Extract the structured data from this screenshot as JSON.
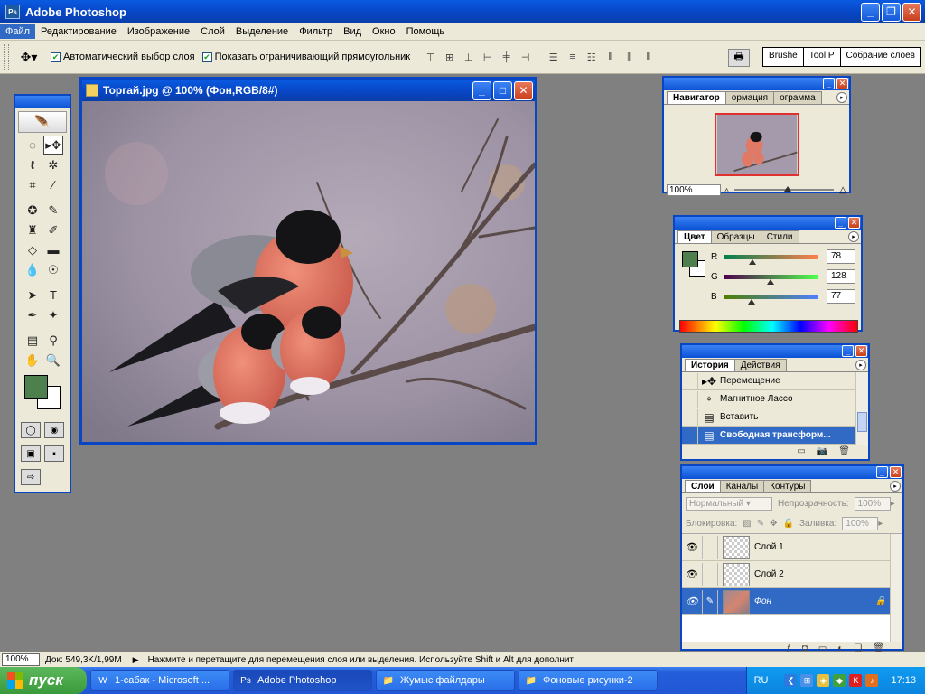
{
  "app": {
    "title": "Adobe Photoshop",
    "logo_text": "Ps"
  },
  "menu": [
    {
      "label": "Файл",
      "active": true
    },
    {
      "label": "Редактирование"
    },
    {
      "label": "Изображение"
    },
    {
      "label": "Слой"
    },
    {
      "label": "Выделение"
    },
    {
      "label": "Фильтр"
    },
    {
      "label": "Вид"
    },
    {
      "label": "Окно"
    },
    {
      "label": "Помощь"
    }
  ],
  "options": {
    "auto_select_label": "Автоматический выбор слоя",
    "auto_select_checked": true,
    "show_bounds_label": "Показать ограничивающий прямоугольник",
    "show_bounds_checked": true,
    "well_tabs": [
      "Brushe",
      "Tool P",
      "Собрание слоев"
    ]
  },
  "document": {
    "title": "Торгай.jpg @ 100% (Фон,RGB/8#)"
  },
  "navigator": {
    "tabs": [
      "Навигатор",
      "ормация",
      "ограмма"
    ],
    "zoom": "100%"
  },
  "color": {
    "tabs": [
      "Цвет",
      "Образцы",
      "Стили"
    ],
    "channels": [
      {
        "label": "R",
        "value": "78",
        "level": 0.306,
        "gradient": "linear-gradient(90deg, #00804d, #ff804d)"
      },
      {
        "label": "G",
        "value": "128",
        "level": 0.502,
        "gradient": "linear-gradient(90deg, #4e004d, #4eff4d)"
      },
      {
        "label": "B",
        "value": "77",
        "level": 0.302,
        "gradient": "linear-gradient(90deg, #4e8000, #4e80ff)"
      }
    ],
    "fg_hex": "#4e804d"
  },
  "history": {
    "tabs": [
      "История",
      "Действия"
    ],
    "items": [
      {
        "label": "Перемещение",
        "icon": "▸✥",
        "selected": false
      },
      {
        "label": "Магнитное Лассо",
        "icon": "⌖",
        "selected": false
      },
      {
        "label": "Вставить",
        "icon": "▤",
        "selected": false
      },
      {
        "label": "Свободная трансформ...",
        "icon": "▤",
        "selected": true
      }
    ]
  },
  "layers": {
    "tabs": [
      "Слои",
      "Каналы",
      "Контуры"
    ],
    "blend_mode": "Нормальный",
    "opacity_label": "Непрозрачность:",
    "opacity_value": "100%",
    "lock_label": "Блокировка:",
    "fill_label": "Заливка:",
    "fill_value": "100%",
    "items": [
      {
        "name": "Слой 1",
        "selected": false,
        "thumb": "transparent",
        "lock": ""
      },
      {
        "name": "Слой 2",
        "selected": false,
        "thumb": "transparent",
        "lock": ""
      },
      {
        "name": "Фон",
        "selected": true,
        "thumb": "photo",
        "lock": "🔒"
      }
    ]
  },
  "status": {
    "zoom": "100%",
    "doc_size": "Док: 549,3K/1,99M",
    "hint": "Нажмите и перетащите для перемещения слоя или выделения. Используйте Shift и Alt для дополнит"
  },
  "taskbar": {
    "start_label": "пуск",
    "tasks": [
      {
        "label": "1-сабак - Microsoft ...",
        "icon": "W",
        "active": false
      },
      {
        "label": "Adobe Photoshop",
        "icon": "Ps",
        "active": true
      },
      {
        "label": "Жумыс файлдары",
        "icon": "📁",
        "active": false
      },
      {
        "label": "Фоновые рисунки-2",
        "icon": "📁",
        "active": false
      }
    ],
    "lang": "RU",
    "clock": "17:13"
  }
}
